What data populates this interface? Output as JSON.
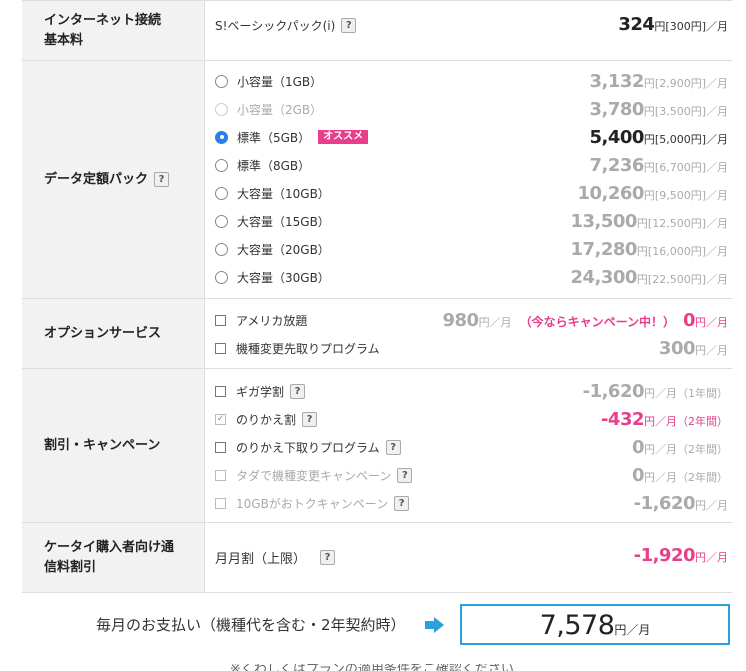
{
  "sections": [
    {
      "label": "インターネット接続基本料",
      "rows": [
        {
          "type": "plain",
          "text": "S!ベーシックパック(i)",
          "help": "?",
          "price": "324",
          "price_sub": "円[300円]／月",
          "style": "dark"
        }
      ]
    },
    {
      "label": "データ定額パック",
      "help": "?",
      "rows": [
        {
          "type": "radio",
          "text": "小容量（1GB）",
          "price": "3,132",
          "price_sub": "円[2,900円]／月",
          "style": "gray",
          "checked": false
        },
        {
          "type": "radio",
          "text": "小容量（2GB）",
          "price": "3,780",
          "price_sub": "円[3,500円]／月",
          "style": "gray",
          "checked": false,
          "disabled": true
        },
        {
          "type": "radio",
          "text": "標準（5GB）",
          "tag": "オススメ",
          "price": "5,400",
          "price_sub": "円[5,000円]／月",
          "style": "dark",
          "checked": true
        },
        {
          "type": "radio",
          "text": "標準（8GB）",
          "price": "7,236",
          "price_sub": "円[6,700円]／月",
          "style": "gray",
          "checked": false
        },
        {
          "type": "radio",
          "text": "大容量（10GB）",
          "price": "10,260",
          "price_sub": "円[9,500円]／月",
          "style": "gray",
          "checked": false
        },
        {
          "type": "radio",
          "text": "大容量（15GB）",
          "price": "13,500",
          "price_sub": "円[12,500円]／月",
          "style": "gray",
          "checked": false
        },
        {
          "type": "radio",
          "text": "大容量（20GB）",
          "price": "17,280",
          "price_sub": "円[16,000円]／月",
          "style": "gray",
          "checked": false
        },
        {
          "type": "radio",
          "text": "大容量（30GB）",
          "price": "24,300",
          "price_sub": "円[22,500円]／月",
          "style": "gray",
          "checked": false
        }
      ]
    },
    {
      "label": "オプションサービス",
      "rows": [
        {
          "type": "check",
          "text": "アメリカ放題",
          "price": "980",
          "price_sub": "円／月",
          "campaign": "（今ならキャンペーン中！）",
          "price2": "0",
          "price2_sub": "円／月",
          "style": "gray"
        },
        {
          "type": "check",
          "text": "機種変更先取りプログラム",
          "price": "300",
          "price_sub": "円／月",
          "style": "gray"
        }
      ]
    },
    {
      "label": "割引・キャンペーン",
      "rows": [
        {
          "type": "check",
          "text": "ギガ学割",
          "help": "?",
          "price": "-1,620",
          "price_sub": "円／月（1年間）",
          "style": "gray"
        },
        {
          "type": "check",
          "text": "のりかえ割",
          "help": "?",
          "checked": true,
          "price": "-432",
          "price_sub": "円／月（2年間）",
          "style": "pink"
        },
        {
          "type": "check",
          "text": "のりかえ下取りプログラム",
          "help": "?",
          "price": "0",
          "price_sub": "円／月（2年間）",
          "style": "gray"
        },
        {
          "type": "check",
          "text": "タダで機種変更キャンペーン",
          "help": "?",
          "disabled": true,
          "price": "0",
          "price_sub": "円／月（2年間）",
          "style": "gray"
        },
        {
          "type": "check",
          "text": "10GBがおトクキャンペーン",
          "help": "?",
          "disabled": true,
          "price": "-1,620",
          "price_sub": "円／月",
          "style": "gray"
        }
      ]
    },
    {
      "label": "ケータイ購入者向け通信料割引",
      "rows": [
        {
          "type": "plain",
          "text": "月月割（上限）",
          "help": "?",
          "price": "-1,920",
          "price_sub": "円／月",
          "style": "pink"
        }
      ]
    }
  ],
  "total": {
    "label": "毎月のお支払い（機種代を含む・2年契約時）",
    "value": "7,578",
    "unit": "円／月"
  },
  "footer_partial": "※くわしくはプランの適用条件をご確認ください"
}
